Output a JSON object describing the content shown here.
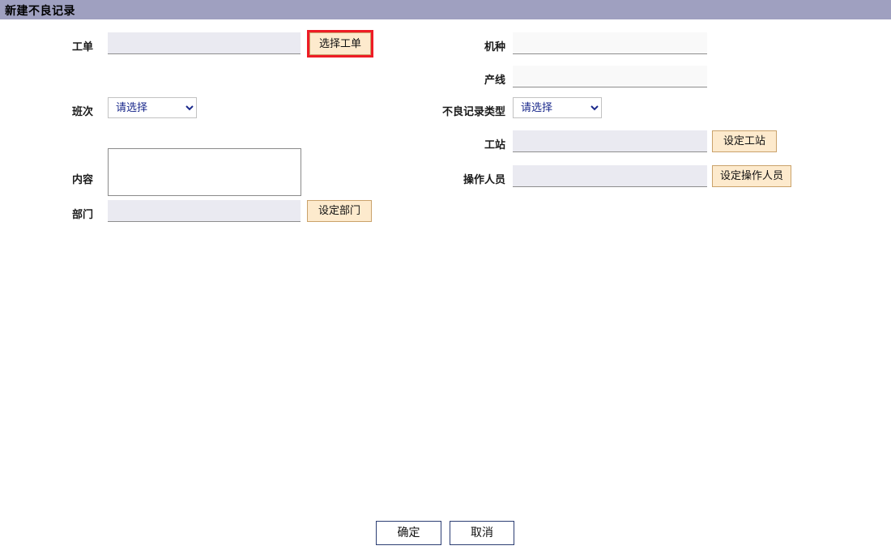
{
  "window": {
    "title": "新建不良记录",
    "titlebar_color": "#9fa0c0"
  },
  "colors": {
    "titlebar": "#9fa0c0",
    "field_fill": "#eaeaf1",
    "field_fill_readonly": "#f9f9f9",
    "tan_button_fill": "#fdeacd",
    "tan_button_border": "#caa26b",
    "highlight_ring": "#ee1c25",
    "footer_button_border": "#2c3e73",
    "select_text": "#1b2a8c"
  },
  "form": {
    "left_column": {
      "work_order": {
        "label": "工单",
        "value": "",
        "placeholder": "",
        "button_label": "选择工单",
        "button_highlighted": true
      },
      "shift": {
        "label": "班次",
        "selected": "请选择",
        "options": [
          "请选择"
        ]
      },
      "content": {
        "label": "内容",
        "value": "",
        "placeholder": ""
      },
      "department": {
        "label": "部门",
        "value": "",
        "placeholder": "",
        "button_label": "设定部门",
        "button_highlighted": false
      }
    },
    "right_column": {
      "model": {
        "label": "机种",
        "value": "",
        "placeholder": "",
        "readonly": true
      },
      "production_line": {
        "label": "产线",
        "value": "",
        "placeholder": "",
        "readonly": true
      },
      "defect_record_type": {
        "label": "不良记录类型",
        "selected": "请选择",
        "options": [
          "请选择"
        ]
      },
      "workstation": {
        "label": "工站",
        "value": "",
        "placeholder": "",
        "button_label": "设定工站",
        "button_highlighted": false
      },
      "operator": {
        "label": "操作人员",
        "value": "",
        "placeholder": "",
        "button_label": "设定操作人员",
        "button_highlighted": false
      }
    }
  },
  "footer": {
    "confirm_label": "确定",
    "cancel_label": "取消"
  }
}
